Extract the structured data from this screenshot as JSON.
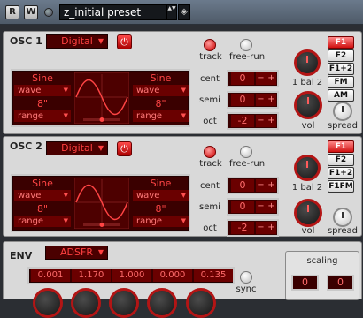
{
  "toolbar": {
    "btn_r": "R",
    "btn_w": "W",
    "preset_name": "z_initial preset",
    "arrows": "▲▼",
    "icon": "◈"
  },
  "osc1": {
    "title": "OSC 1",
    "mode": "Digital",
    "power": "⏻",
    "left": {
      "top": "Sine",
      "field1": "wave",
      "mid": "8\"",
      "field2": "range"
    },
    "right": {
      "top": "Sine",
      "field1": "wave",
      "mid": "8\"",
      "field2": "range"
    },
    "track": "track",
    "freerun": "free-run",
    "cent_label": "cent",
    "cent": "0",
    "semi_label": "semi",
    "semi": "0",
    "oct_label": "oct",
    "oct": "-2",
    "bal_label": "1 bal 2",
    "vol_label": "vol",
    "spread_label": "spread"
  },
  "osc2": {
    "title": "OSC 2",
    "mode": "Digital",
    "power": "⏻",
    "left": {
      "top": "Sine",
      "field1": "wave",
      "mid": "8\"",
      "field2": "range"
    },
    "right": {
      "top": "Sine",
      "field1": "wave",
      "mid": "8\"",
      "field2": "range"
    },
    "track": "track",
    "freerun": "free-run",
    "cent_label": "cent",
    "cent": "0",
    "semi_label": "semi",
    "semi": "0",
    "oct_label": "oct",
    "oct": "-2",
    "bal_label": "1 bal 2",
    "vol_label": "vol",
    "spread_label": "spread"
  },
  "filter_modes_1": [
    "F1",
    "F2",
    "F1+2",
    "FM",
    "AM"
  ],
  "filter_modes_2": [
    "F1",
    "F2",
    "F1+2",
    "F1FM"
  ],
  "env": {
    "title": "ENV",
    "mode": "ADSFR",
    "values": [
      "0.001",
      "1.170",
      "1.000",
      "0.000",
      "0.135"
    ],
    "sync": "sync",
    "scaling_label": "scaling",
    "scaling_values": [
      "0",
      "0"
    ]
  },
  "colors": {
    "accent": "#cc1010",
    "lcd_bg": "#3a0000",
    "panel": "#d9d9d9"
  }
}
